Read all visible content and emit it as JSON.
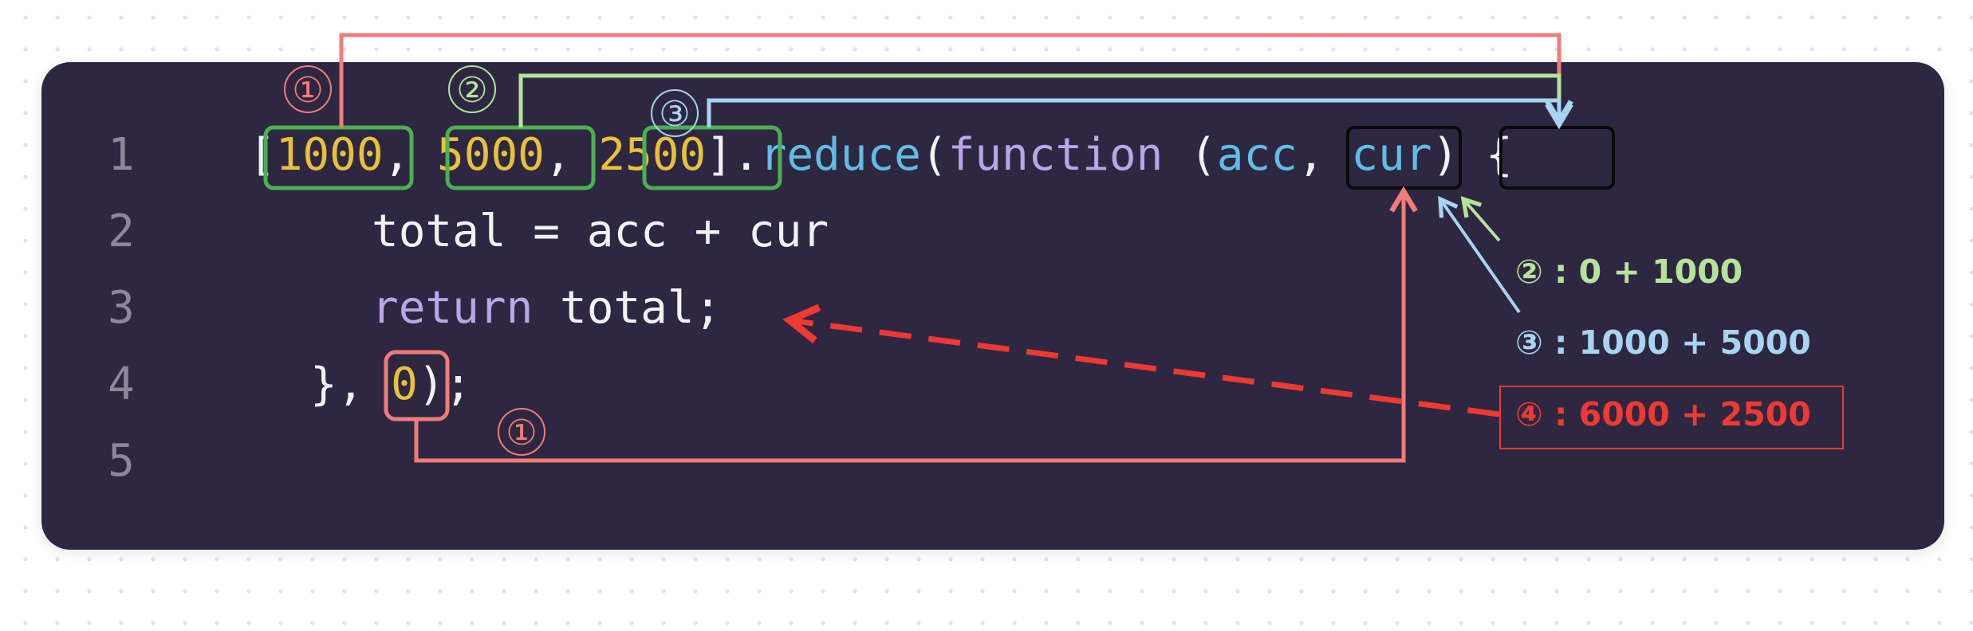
{
  "line_numbers": [
    "1",
    "2",
    "3",
    "4",
    "5"
  ],
  "code": {
    "line1": {
      "bracket_open": "[",
      "n1": "1000",
      "sep1": ", ",
      "n2": "5000",
      "sep2": ", ",
      "n3": "2500",
      "bracket_close": "]",
      "dot": ".",
      "method": "reduce",
      "paren_open": "(",
      "keyword": "function",
      "space": " (",
      "param1": "acc",
      "sep3": ", ",
      "param2": "cur",
      "tail": ") {"
    },
    "line2": {
      "lhs": "total",
      "rest": " = acc + cur"
    },
    "line3": {
      "keyword": "return",
      "rest": " total;"
    },
    "line4": {
      "head": "}, ",
      "init": "0",
      "tail": ");"
    }
  },
  "markers": {
    "one": "①",
    "two": "②",
    "three": "③",
    "four": "④"
  },
  "annotations": {
    "step2": {
      "marker": "②",
      "text": " : 0 + 1000"
    },
    "step3": {
      "marker": "③",
      "text": " : 1000 + 5000"
    },
    "step4": {
      "marker": "④",
      "text": " : 6000 + 2500"
    }
  },
  "colors": {
    "panel_bg": "#2e2742",
    "number": "#e8c13a",
    "keyword": "#b9a6e8",
    "function_name": "#5fbde6",
    "step1_red": "#f07c78",
    "step2_green": "#b6e39a",
    "step3_blue": "#a8d4f2",
    "step4_red": "#ee3a30",
    "array_box_green": "#4caf50"
  }
}
